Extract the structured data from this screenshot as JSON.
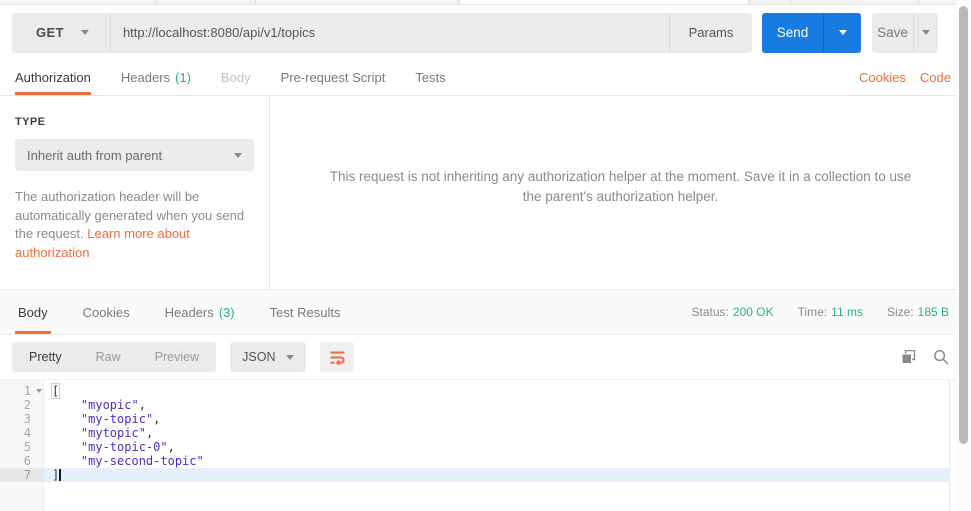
{
  "request_bar": {
    "method": "GET",
    "url": "http://localhost:8080/api/v1/topics",
    "params_label": "Params",
    "send_label": "Send",
    "save_label": "Save"
  },
  "request_tabs": {
    "items": [
      {
        "label": "Authorization",
        "state": "active"
      },
      {
        "label": "Headers",
        "count": "(1)",
        "state": "normal"
      },
      {
        "label": "Body",
        "state": "muted"
      },
      {
        "label": "Pre-request Script",
        "state": "normal"
      },
      {
        "label": "Tests",
        "state": "normal"
      }
    ],
    "cookies_label": "Cookies",
    "code_label": "Code"
  },
  "auth_panel": {
    "type_label": "TYPE",
    "type_value": "Inherit auth from parent",
    "help_text": "The authorization header will be automatically generated when you send the request. ",
    "help_link": "Learn more about authorization",
    "inherit_message": "This request is not inheriting any authorization helper at the moment. Save it in a collection to use the parent's authorization helper."
  },
  "response_tabs": {
    "items": [
      {
        "label": "Body",
        "state": "active"
      },
      {
        "label": "Cookies",
        "state": "normal"
      },
      {
        "label": "Headers",
        "count": "(3)",
        "state": "normal"
      },
      {
        "label": "Test Results",
        "state": "normal"
      }
    ]
  },
  "response_meta": {
    "status_label": "Status:",
    "status_value": "200 OK",
    "time_label": "Time:",
    "time_value": "11 ms",
    "size_label": "Size:",
    "size_value": "185 B"
  },
  "response_toolbar": {
    "views": [
      {
        "label": "Pretty",
        "state": "active"
      },
      {
        "label": "Raw",
        "state": "normal"
      },
      {
        "label": "Preview",
        "state": "normal"
      }
    ],
    "format_value": "JSON",
    "icons": {
      "wrap": "wrap-text-icon",
      "copy": "copy-icon",
      "search": "search-icon"
    }
  },
  "response_body": {
    "lines": [
      {
        "num": "1",
        "fold": true,
        "code": [
          [
            "bracket",
            "["
          ]
        ]
      },
      {
        "num": "2",
        "code": [
          [
            "indent",
            "    "
          ],
          [
            "string",
            "\"myopic\""
          ],
          [
            "punct",
            ","
          ]
        ]
      },
      {
        "num": "3",
        "code": [
          [
            "indent",
            "    "
          ],
          [
            "string",
            "\"my-topic\""
          ],
          [
            "punct",
            ","
          ]
        ]
      },
      {
        "num": "4",
        "code": [
          [
            "indent",
            "    "
          ],
          [
            "string",
            "\"mytopic\""
          ],
          [
            "punct",
            ","
          ]
        ]
      },
      {
        "num": "5",
        "code": [
          [
            "indent",
            "    "
          ],
          [
            "string",
            "\"my-topic-0\""
          ],
          [
            "punct",
            ","
          ]
        ]
      },
      {
        "num": "6",
        "code": [
          [
            "indent",
            "    "
          ],
          [
            "string",
            "\"my-second-topic\""
          ]
        ]
      },
      {
        "num": "7",
        "active": true,
        "cursor": true,
        "code": [
          [
            "punct",
            "]"
          ]
        ]
      }
    ]
  },
  "colors": {
    "accent_orange": "#f26b3a",
    "send_blue": "#177be2",
    "success_green": "#2ab27b",
    "string_purple": "#4632c8",
    "active_line_blue": "#e4f1fc"
  }
}
